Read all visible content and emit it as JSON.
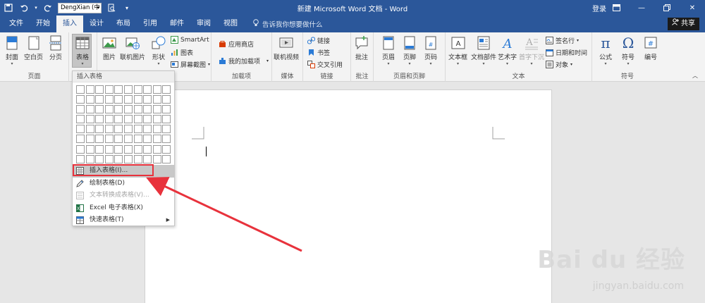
{
  "titlebar": {
    "font_name": "DengXian (中",
    "title": "新建 Microsoft Word 文档  -  Word",
    "login": "登录"
  },
  "tabs": [
    "文件",
    "开始",
    "插入",
    "设计",
    "布局",
    "引用",
    "邮件",
    "审阅",
    "视图"
  ],
  "active_tab": "插入",
  "tellme": "告诉我你想要做什么",
  "share": "共享",
  "ribbon": {
    "pages": {
      "label": "页面",
      "cover": "封面",
      "blank": "空白页",
      "break": "分页"
    },
    "tables": {
      "table": "表格"
    },
    "illustrations": {
      "picture": "图片",
      "online_picture": "联机图片",
      "shapes": "形状",
      "smartart": "SmartArt",
      "chart": "图表",
      "screenshot": "屏幕截图"
    },
    "addins": {
      "label": "加载项",
      "store": "应用商店",
      "my_addins": "我的加载项"
    },
    "media": {
      "label": "媒体",
      "online_video": "联机视频"
    },
    "links": {
      "label": "链接",
      "link": "链接",
      "bookmark": "书签",
      "cross_ref": "交叉引用"
    },
    "comments": {
      "label": "批注",
      "comment": "批注"
    },
    "header_footer": {
      "label": "页眉和页脚",
      "header": "页眉",
      "footer": "页脚",
      "page_number": "页码"
    },
    "text": {
      "label": "文本",
      "textbox": "文本框",
      "quick_parts": "文档部件",
      "wordart": "艺术字",
      "dropcap": "首字下沉",
      "signature": "签名行",
      "datetime": "日期和时间",
      "object": "对象"
    },
    "symbols": {
      "label": "符号",
      "equation": "公式",
      "symbol": "符号",
      "number": "编号"
    }
  },
  "dropdown": {
    "title": "插入表格",
    "items": [
      {
        "label": "插入表格(I)...",
        "highlighted": true,
        "disabled": false
      },
      {
        "label": "绘制表格(D)",
        "highlighted": false,
        "disabled": false
      },
      {
        "label": "文本转换成表格(V)...",
        "highlighted": false,
        "disabled": true
      },
      {
        "label": "Excel 电子表格(X)",
        "highlighted": false,
        "disabled": false
      },
      {
        "label": "快速表格(T)",
        "highlighted": false,
        "disabled": false
      }
    ]
  },
  "watermark": {
    "brand": "Bai du 经验",
    "url": "jingyan.baidu.com"
  },
  "colors": {
    "accent": "#2b579a",
    "highlight_box": "#e8323c",
    "arrow": "#e8323c"
  }
}
